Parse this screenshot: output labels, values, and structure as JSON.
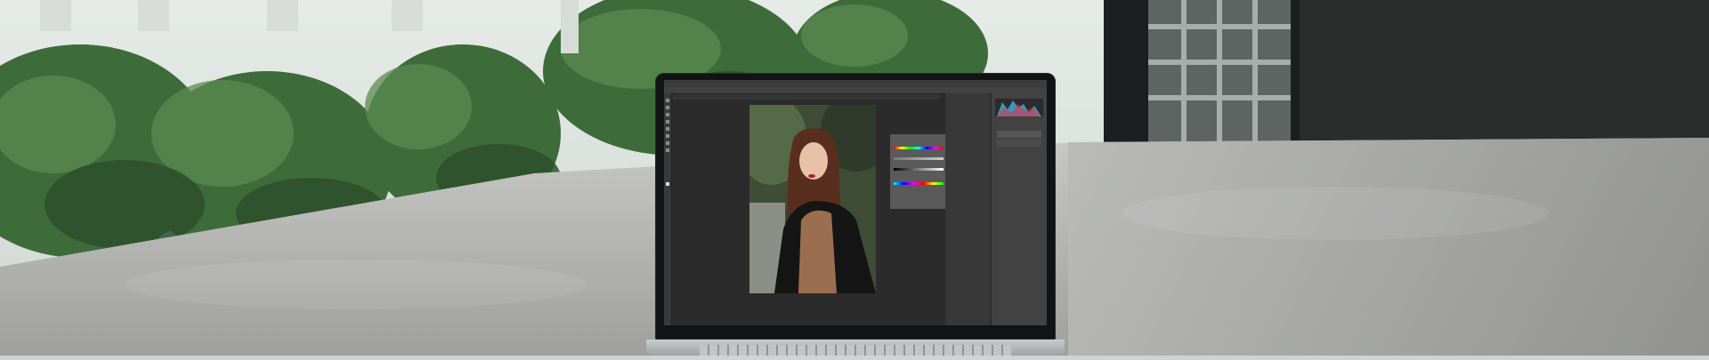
{
  "scene": {
    "description_colors": {
      "sky": "#d9dedc",
      "plants": "#3e6b3a",
      "table": "#a9aaa8",
      "window": "#1e2122"
    }
  },
  "laptop": {
    "app": {
      "menu": [
        "",
        "",
        "",
        "",
        "",
        "",
        "",
        "",
        "",
        ""
      ],
      "options_text": "",
      "doc_tab": "",
      "panel_labels": [
        "",
        ""
      ]
    }
  }
}
